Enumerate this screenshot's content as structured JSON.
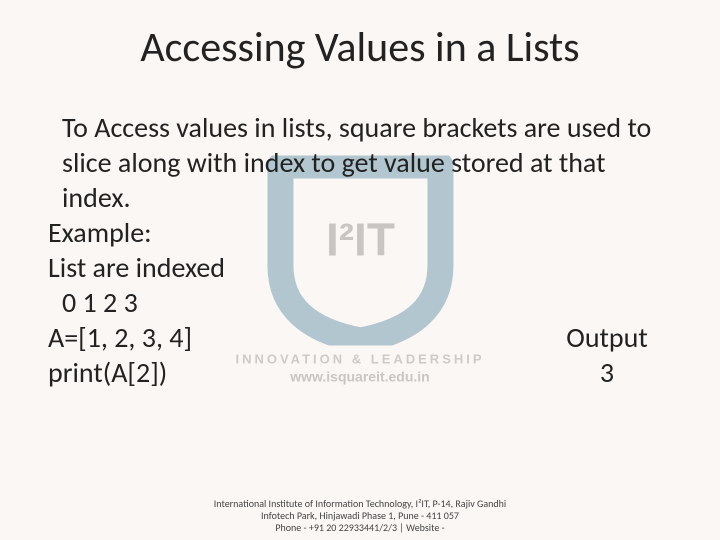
{
  "title": "Accessing Values in a Lists",
  "body": {
    "p1": "To Access values in lists, square brackets are used to slice along with index to get value stored at that index.",
    "example_label": "Example:",
    "indexed_label": "List are indexed",
    "indices": "0 1 2 3",
    "assign": "A=[1, 2, 3, 4]",
    "print_stmt": "print(A[2])",
    "output_label": "Output",
    "output_value": "3"
  },
  "watermark": {
    "logo_text": "I²IT",
    "tagline": "INNOVATION & LEADERSHIP",
    "url": "www.isquareit.edu.in"
  },
  "footer": {
    "line1": "International Institute of Information Technology, I²IT, P-14, Rajiv Gandhi Infotech Park, Hinjawadi Phase 1, Pune - 411 057",
    "line2": "Phone - +91 20 22933441/2/3 | Website -"
  }
}
